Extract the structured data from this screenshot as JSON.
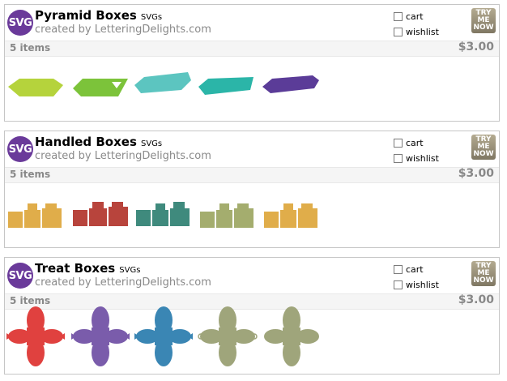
{
  "badge_text": "SVG",
  "cart_label": "cart",
  "wishlist_label": "wishlist",
  "try_button": [
    "TRY",
    "ME",
    "NOW"
  ],
  "products": [
    {
      "name": "Pyramid Boxes",
      "format": "SVGs",
      "byline": "created by LetteringDelights.com",
      "item_count": "5 items",
      "price": "$3.00",
      "thumb_colors": [
        "#b5d33c",
        "#7cc33a",
        "#5cc5c0",
        "#2bb5a8",
        "#5b3c98"
      ]
    },
    {
      "name": "Handled Boxes",
      "format": "SVGs",
      "byline": "created by LetteringDelights.com",
      "item_count": "5 items",
      "price": "$3.00",
      "thumb_colors": [
        "#e0ad4a",
        "#b8443c",
        "#3f8a7d",
        "#a4ad6e",
        "#e0ad4a"
      ]
    },
    {
      "name": "Treat Boxes",
      "format": "SVGs",
      "byline": "created by LetteringDelights.com",
      "item_count": "5 items",
      "price": "$3.00",
      "thumb_colors": [
        "#e0413f",
        "#7a5cab",
        "#3a86b4",
        "#9fa57b",
        "#9fa57b"
      ]
    }
  ]
}
